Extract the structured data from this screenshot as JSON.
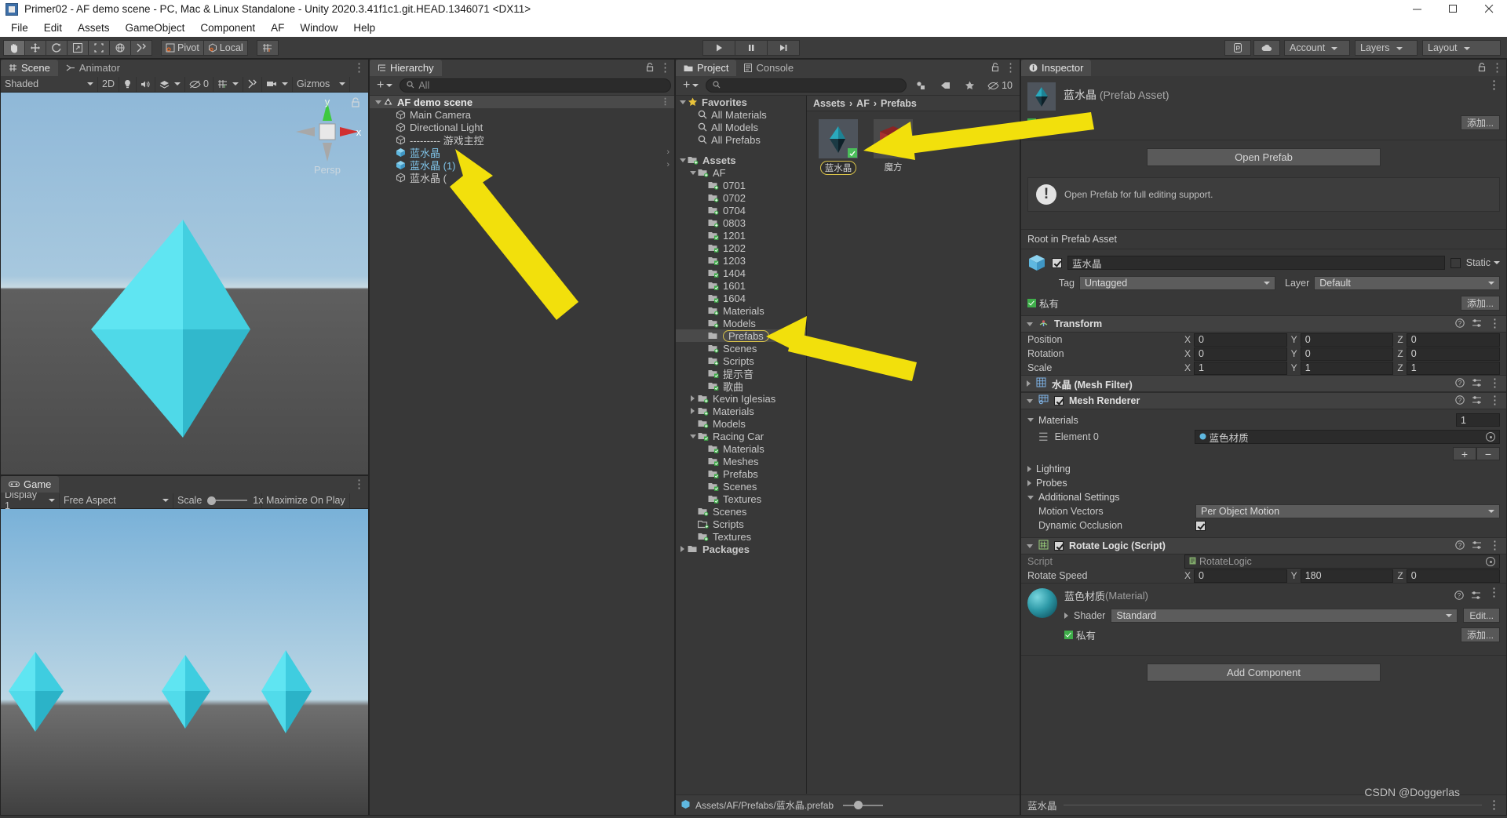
{
  "window": {
    "title": "Primer02 - AF demo scene - PC, Mac & Linux Standalone - Unity 2020.3.41f1c1.git.HEAD.1346071 <DX11>",
    "minimize": "minimize-icon",
    "maximize": "maximize-icon",
    "close": "close-icon"
  },
  "menu": {
    "items": [
      "File",
      "Edit",
      "Assets",
      "GameObject",
      "Component",
      "AF",
      "Window",
      "Help"
    ]
  },
  "toolbar": {
    "tools": [
      "hand-tool",
      "move-tool",
      "rotate-tool",
      "scale-tool",
      "rect-tool",
      "transform-tool",
      "custom-tool"
    ],
    "pivot_label": "Pivot",
    "local_label": "Local",
    "grid_label": "grid-snap-icon",
    "play": "play-icon",
    "pause": "pause-icon",
    "step": "step-icon",
    "collab_label": "collab-icon",
    "cloud_label": "cloud-icon",
    "account_label": "Account",
    "layers_label": "Layers",
    "layout_label": "Layout"
  },
  "scene": {
    "tabs": [
      {
        "label": "Scene",
        "icon": "grid-icon",
        "selected": true
      },
      {
        "label": "Animator",
        "icon": "animator-icon",
        "selected": false
      }
    ],
    "viewbar": {
      "shading": "Shaded",
      "two_d": "2D",
      "lighting": "light-icon",
      "audio": "audio-icon",
      "fx": "fx-icon",
      "hidden_count": "0",
      "grid": "grid-visibility-icon",
      "tools": "scene-tools-icon",
      "camera": "camera-icon",
      "gizmos": "Gizmos"
    },
    "gizmo": {
      "x_label": "x",
      "y_label": "y",
      "mode": "Persp"
    }
  },
  "game": {
    "tab_label": "Game",
    "display": "Display 1",
    "aspect": "Free Aspect",
    "scale_label": "Scale",
    "scale_value": "1x",
    "maximize_label": "Maximize On Play"
  },
  "hierarchy": {
    "tab_label": "Hierarchy",
    "search_placeholder": "All",
    "add_label": "+",
    "items": [
      {
        "label": "AF demo scene",
        "depth": 0,
        "icon": "unity-scene-icon",
        "kind": "scene",
        "expanded": true
      },
      {
        "label": "Main Camera",
        "depth": 1,
        "icon": "gameobject-icon",
        "kind": "normal"
      },
      {
        "label": "Directional Light",
        "depth": 1,
        "icon": "gameobject-icon",
        "kind": "normal"
      },
      {
        "label": "--------- 游戏主控",
        "depth": 1,
        "icon": "gameobject-icon",
        "kind": "normal"
      },
      {
        "label": "蓝水晶",
        "depth": 1,
        "icon": "prefab-icon",
        "kind": "prefab",
        "has_child_arrow": true
      },
      {
        "label": "蓝水晶 (1)",
        "depth": 1,
        "icon": "prefab-icon",
        "kind": "prefab",
        "has_child_arrow": true
      },
      {
        "label": "蓝水晶 (",
        "depth": 1,
        "icon": "gameobject-icon",
        "kind": "normal"
      }
    ]
  },
  "project": {
    "tabs": [
      {
        "label": "Project",
        "icon": "folder-icon",
        "selected": true
      },
      {
        "label": "Console",
        "icon": "console-icon",
        "selected": false
      }
    ],
    "search_placeholder": "",
    "filter_icons": [
      "type-filter-icon",
      "label-filter-icon",
      "favorite-star-icon"
    ],
    "hidden_count": "10",
    "breadcrumb": [
      "Assets",
      "AF",
      "Prefabs"
    ],
    "tree": [
      {
        "label": "Favorites",
        "depth": 0,
        "icon": "star-icon",
        "expanded": true,
        "bold": true
      },
      {
        "label": "All Materials",
        "depth": 1,
        "icon": "search-icon"
      },
      {
        "label": "All Models",
        "depth": 1,
        "icon": "search-icon"
      },
      {
        "label": "All Prefabs",
        "depth": 1,
        "icon": "search-icon"
      },
      {
        "label": "",
        "depth": 0,
        "icon": "spacer",
        "spacer": true
      },
      {
        "label": "Assets",
        "depth": 0,
        "icon": "folder-plus-icon",
        "expanded": true,
        "bold": true
      },
      {
        "label": "AF",
        "depth": 1,
        "icon": "folder-plus-icon",
        "expanded": true,
        "bold": false
      },
      {
        "label": "0701",
        "depth": 2,
        "icon": "folder-plus-icon"
      },
      {
        "label": "0702",
        "depth": 2,
        "icon": "folder-plus-icon"
      },
      {
        "label": "0704",
        "depth": 2,
        "icon": "folder-plus-icon"
      },
      {
        "label": "0803",
        "depth": 2,
        "icon": "folder-plus-icon"
      },
      {
        "label": "1201",
        "depth": 2,
        "icon": "folder-check-icon"
      },
      {
        "label": "1202",
        "depth": 2,
        "icon": "folder-check-icon"
      },
      {
        "label": "1203",
        "depth": 2,
        "icon": "folder-check-icon"
      },
      {
        "label": "1404",
        "depth": 2,
        "icon": "folder-check-icon"
      },
      {
        "label": "1601",
        "depth": 2,
        "icon": "folder-check-icon"
      },
      {
        "label": "1604",
        "depth": 2,
        "icon": "folder-check-icon"
      },
      {
        "label": "Materials",
        "depth": 2,
        "icon": "folder-plus-icon"
      },
      {
        "label": "Models",
        "depth": 2,
        "icon": "folder-plus-icon"
      },
      {
        "label": "Prefabs",
        "depth": 2,
        "icon": "folder-icon",
        "selected": true
      },
      {
        "label": "Scenes",
        "depth": 2,
        "icon": "folder-plus-icon"
      },
      {
        "label": "Scripts",
        "depth": 2,
        "icon": "folder-plus-icon"
      },
      {
        "label": "提示音",
        "depth": 2,
        "icon": "folder-check-icon"
      },
      {
        "label": "歌曲",
        "depth": 2,
        "icon": "folder-check-icon"
      },
      {
        "label": "Kevin Iglesias",
        "depth": 1,
        "icon": "folder-plus-icon",
        "collapsed": true
      },
      {
        "label": "Materials",
        "depth": 1,
        "icon": "folder-plus-icon",
        "collapsed": true
      },
      {
        "label": "Models",
        "depth": 1,
        "icon": "folder-plus-icon"
      },
      {
        "label": "Racing Car",
        "depth": 1,
        "icon": "folder-check-icon",
        "expanded": true
      },
      {
        "label": "Materials",
        "depth": 2,
        "icon": "folder-check-icon"
      },
      {
        "label": "Meshes",
        "depth": 2,
        "icon": "folder-check-icon"
      },
      {
        "label": "Prefabs",
        "depth": 2,
        "icon": "folder-check-icon"
      },
      {
        "label": "Scenes",
        "depth": 2,
        "icon": "folder-check-icon"
      },
      {
        "label": "Textures",
        "depth": 2,
        "icon": "folder-check-icon"
      },
      {
        "label": "Scenes",
        "depth": 1,
        "icon": "folder-plus-icon"
      },
      {
        "label": "Scripts",
        "depth": 1,
        "icon": "folder-script-icon"
      },
      {
        "label": "Textures",
        "depth": 1,
        "icon": "folder-plus-icon"
      },
      {
        "label": "Packages",
        "depth": 0,
        "icon": "folder-icon",
        "collapsed": true,
        "bold": true
      }
    ],
    "assets": [
      {
        "name": "蓝水晶",
        "kind": "crystal-prefab",
        "selected": true
      },
      {
        "name": "魔方",
        "kind": "cube-prefab",
        "selected": false
      }
    ],
    "footer_path": "Assets/AF/Prefabs/蓝水晶.prefab"
  },
  "inspector": {
    "tab_label": "Inspector",
    "asset_title": "蓝水晶",
    "asset_title_suffix": " (Prefab Asset)",
    "private_label": "私有",
    "add_label": "添加...",
    "open_prefab_label": "Open Prefab",
    "help_text": "Open Prefab for full editing support.",
    "root_label": "Root in Prefab Asset",
    "object_name": "蓝水晶",
    "static_label": "Static",
    "tag_label": "Tag",
    "tag_value": "Untagged",
    "layer_label": "Layer",
    "layer_value": "Default",
    "transform": {
      "title": "Transform",
      "rows": [
        {
          "label": "Position",
          "x": "0",
          "y": "0",
          "z": "0"
        },
        {
          "label": "Rotation",
          "x": "0",
          "y": "0",
          "z": "0"
        },
        {
          "label": "Scale",
          "x": "1",
          "y": "1",
          "z": "1"
        }
      ]
    },
    "mesh_filter_title": "水晶 (Mesh Filter)",
    "mesh_renderer": {
      "title": "Mesh Renderer",
      "materials_label": "Materials",
      "materials_count": "1",
      "element_label": "Element 0",
      "element_value": "蓝色材质",
      "lighting_label": "Lighting",
      "probes_label": "Probes",
      "additional_label": "Additional Settings",
      "motion_vectors_label": "Motion Vectors",
      "motion_vectors_value": "Per Object Motion",
      "dynamic_occlusion_label": "Dynamic Occlusion"
    },
    "rotate_logic": {
      "title": "Rotate Logic (Script)",
      "script_label": "Script",
      "script_value": "RotateLogic",
      "speed_label": "Rotate Speed",
      "speed_x": "0",
      "speed_y": "180",
      "speed_z": "0"
    },
    "material": {
      "title": "蓝色材质",
      "title_suffix": " (Material)",
      "shader_label": "Shader",
      "shader_value": "Standard",
      "edit_label": "Edit...",
      "private_label": "私有",
      "add_label": "添加..."
    },
    "add_component_label": "Add Component",
    "footer_label": "蓝水晶"
  },
  "watermark": "CSDN @Doggerlas",
  "colors": {
    "accent_yellow": "#f2e00c",
    "panel_bg": "#383838",
    "header_bg": "#3c3c3c",
    "selection": "#4a4a4a",
    "blue_text": "#7fc3e8",
    "crystal_cyan": "#49e2ef"
  }
}
